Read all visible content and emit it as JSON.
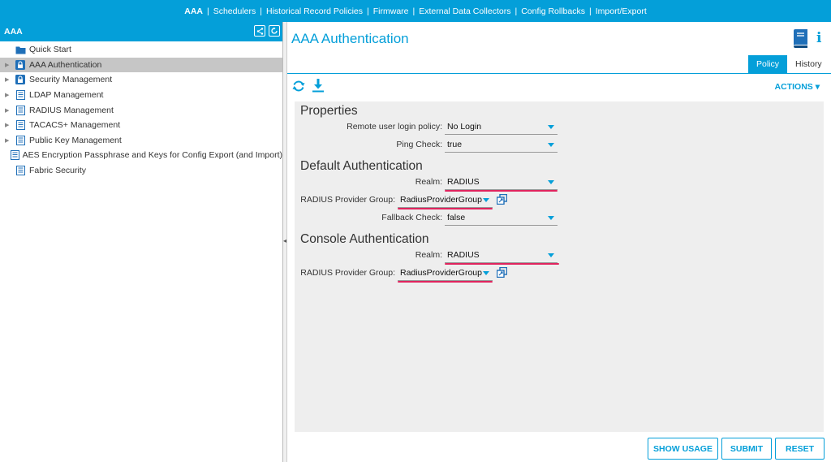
{
  "topnav": {
    "items": [
      "AAA",
      "Schedulers",
      "Historical Record Policies",
      "Firmware",
      "External Data Collectors",
      "Config Rollbacks",
      "Import/Export"
    ],
    "separator": "|"
  },
  "left": {
    "title": "AAA",
    "tree": [
      {
        "label": "Quick Start",
        "icon": "folder-icon",
        "expandable": false,
        "selected": false
      },
      {
        "label": "AAA Authentication",
        "icon": "lock-icon",
        "expandable": true,
        "selected": true
      },
      {
        "label": "Security Management",
        "icon": "lock-icon",
        "expandable": true,
        "selected": false
      },
      {
        "label": "LDAP Management",
        "icon": "list-icon",
        "expandable": true,
        "selected": false
      },
      {
        "label": "RADIUS Management",
        "icon": "list-icon",
        "expandable": true,
        "selected": false
      },
      {
        "label": "TACACS+ Management",
        "icon": "list-icon",
        "expandable": true,
        "selected": false
      },
      {
        "label": "Public Key Management",
        "icon": "list-icon",
        "expandable": true,
        "selected": false
      },
      {
        "label": "AES Encryption Passphrase and Keys for Config Export (and Import)",
        "icon": "list-icon",
        "expandable": false,
        "selected": false
      },
      {
        "label": "Fabric Security",
        "icon": "list-icon",
        "expandable": false,
        "selected": false
      }
    ]
  },
  "main": {
    "title": "AAA Authentication",
    "tabs": {
      "policy": "Policy",
      "history": "History"
    },
    "actions": "ACTIONS",
    "properties": {
      "title": "Properties",
      "remote_login_label": "Remote user login policy:",
      "remote_login_value": "No Login",
      "ping_check_label": "Ping Check:",
      "ping_check_value": "true"
    },
    "default_auth": {
      "title": "Default Authentication",
      "realm_label": "Realm:",
      "realm_value": "RADIUS",
      "provider_label": "RADIUS Provider Group:",
      "provider_value": "RadiusProviderGroup",
      "fallback_label": "Fallback Check:",
      "fallback_value": "false"
    },
    "console_auth": {
      "title": "Console Authentication",
      "realm_label": "Realm:",
      "realm_value": "RADIUS",
      "provider_label": "RADIUS Provider Group:",
      "provider_value": "RadiusProviderGroup"
    },
    "buttons": {
      "show_usage": "SHOW USAGE",
      "submit": "SUBMIT",
      "reset": "RESET"
    }
  },
  "colors": {
    "accent": "#049fd9",
    "highlight": "#e0245e",
    "selected_row": "#c6c6c6",
    "panel": "#eeeeee"
  }
}
